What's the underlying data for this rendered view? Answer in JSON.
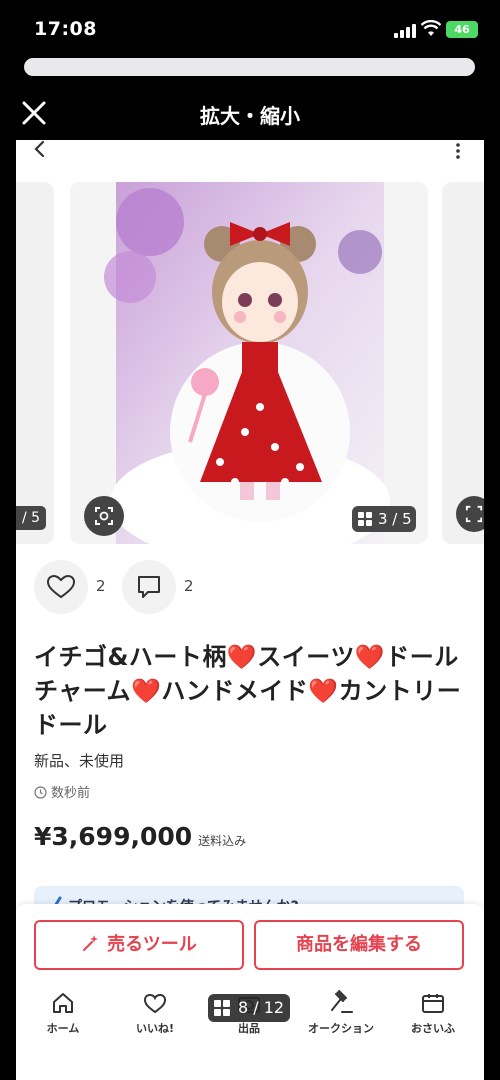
{
  "status": {
    "time": "17:08",
    "battery": "46"
  },
  "modal": {
    "title": "拡大・縮小"
  },
  "carousel": {
    "prev_counter": "/ 5",
    "counter": "3 / 5"
  },
  "stats": {
    "likes": "2",
    "comments": "2"
  },
  "item": {
    "title": "イチゴ&ハート柄❤️スイーツ❤️ドールチャーム❤️ハンドメイド❤️カントリードール",
    "condition": "新品、未使用",
    "posted": "数秒前",
    "price": "¥3,699,000",
    "price_note": "送料込み"
  },
  "banner": {
    "text": "プロモーションを使ってみませんか?"
  },
  "actions": {
    "tools_label": "売るツール",
    "edit_label": "商品を編集する"
  },
  "nav": {
    "items": [
      {
        "label": "ホーム",
        "icon": "home-icon"
      },
      {
        "label": "いいね!",
        "icon": "heart-icon"
      },
      {
        "label": "出品",
        "icon": "camera-icon"
      },
      {
        "label": "オークション",
        "icon": "gavel-icon"
      },
      {
        "label": "おさいふ",
        "icon": "wallet-icon"
      }
    ]
  },
  "overlay": {
    "counter": "8 / 12"
  },
  "colors": {
    "accent": "#e5434f",
    "battery": "#4cd964",
    "banner_bg": "#e8f1fb"
  }
}
